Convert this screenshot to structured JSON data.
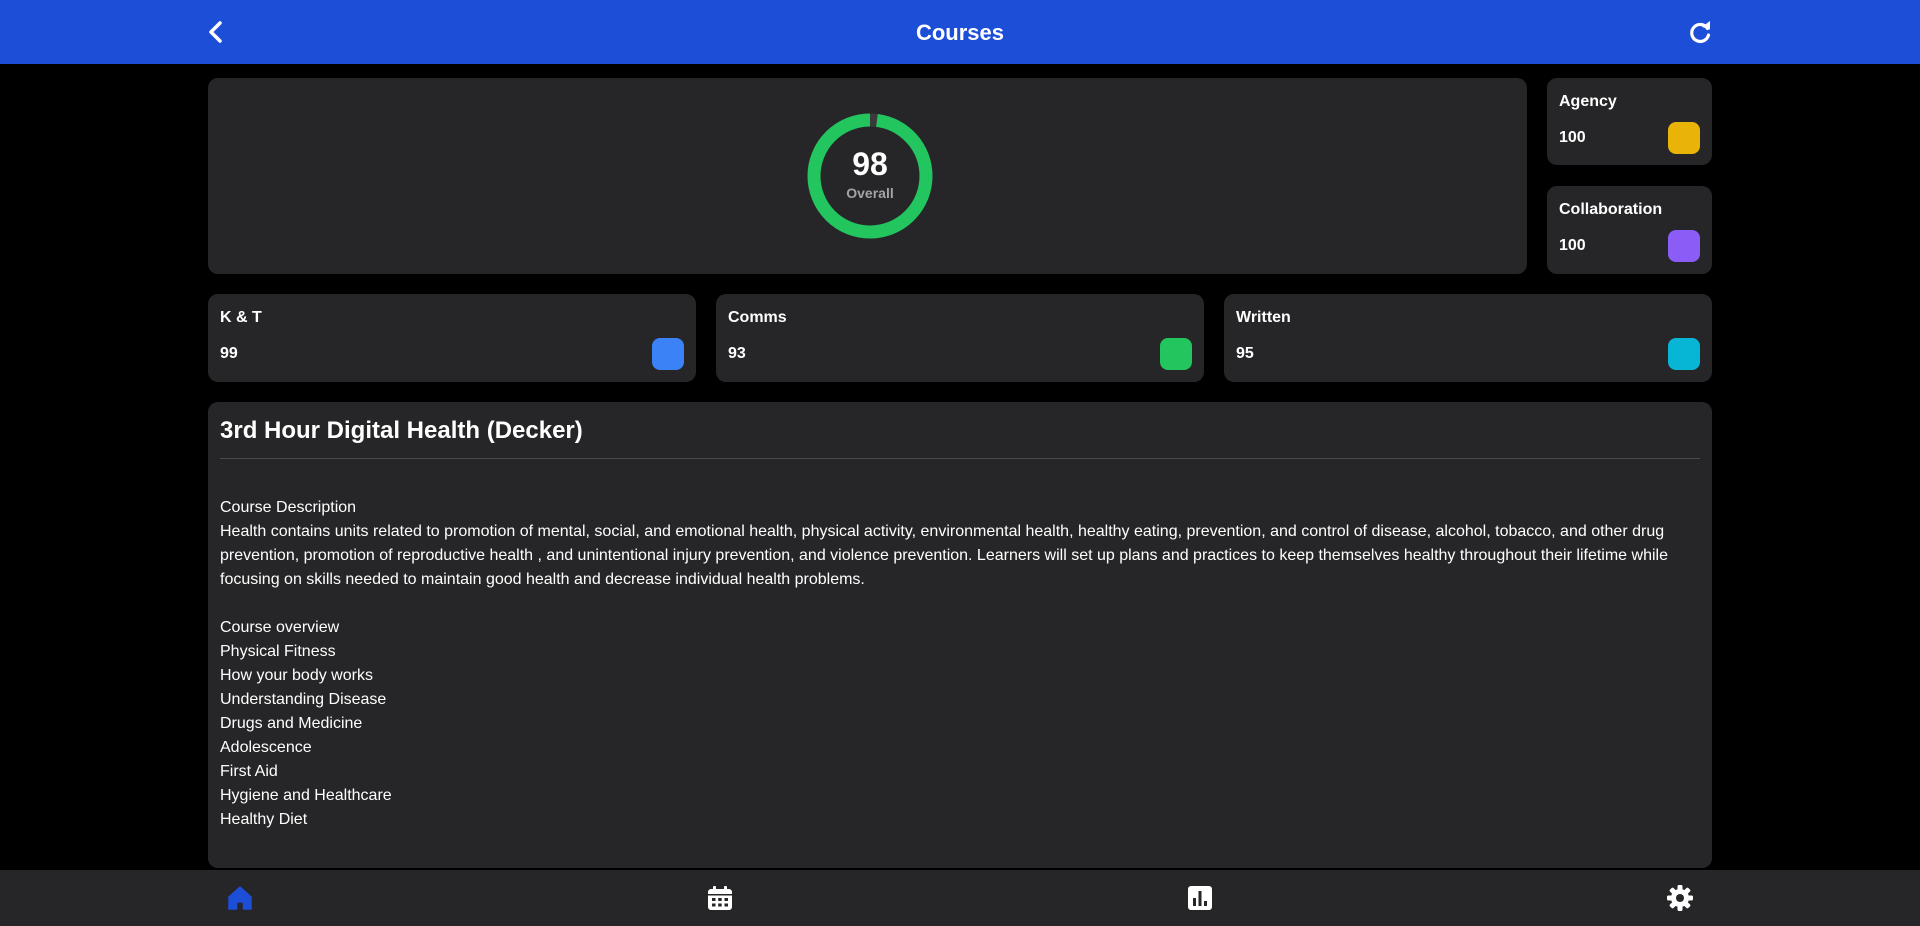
{
  "header": {
    "title": "Courses",
    "back_icon": "chevron-left-icon",
    "refresh_icon": "refresh-icon",
    "background": "#1c4ed8"
  },
  "overall": {
    "value": "98",
    "label": "Overall",
    "progress_percent": 98,
    "ring_color": "#22c55e"
  },
  "scores": [
    {
      "label": "Agency",
      "value": "100",
      "color": "#eab308"
    },
    {
      "label": "Collaboration",
      "value": "100",
      "color": "#8b5cf6"
    },
    {
      "label": "K & T",
      "value": "99",
      "color": "#3b82f6"
    },
    {
      "label": "Comms",
      "value": "93",
      "color": "#22c55e"
    },
    {
      "label": "Written",
      "value": "95",
      "color": "#06b6d4"
    }
  ],
  "course": {
    "title": "3rd Hour Digital Health (Decker)",
    "description_heading": "Course Description",
    "description": "Health contains units related to promotion of mental, social, and emotional health, physical activity, environmental health, healthy eating, prevention, and control of disease, alcohol, tobacco, and other drug prevention, promotion of reproductive health , and unintentional injury prevention, and violence prevention. Learners will set up plans and practices to keep themselves healthy throughout their lifetime while focusing on skills needed to maintain good health and decrease individual health problems.",
    "overview_heading": "Course overview",
    "overview_items": [
      "Physical Fitness",
      "How your body works",
      "Understanding Disease",
      "Drugs and Medicine",
      "Adolescence",
      "First Aid",
      "Hygiene and Healthcare",
      "Healthy Diet"
    ]
  },
  "bottom_nav": [
    {
      "icon": "home-icon",
      "active": true,
      "color": "#1c4ed8"
    },
    {
      "icon": "calendar-icon",
      "active": false,
      "color": "#ffffff"
    },
    {
      "icon": "chart-icon",
      "active": false,
      "color": "#ffffff"
    },
    {
      "icon": "gear-icon",
      "active": false,
      "color": "#ffffff"
    }
  ]
}
